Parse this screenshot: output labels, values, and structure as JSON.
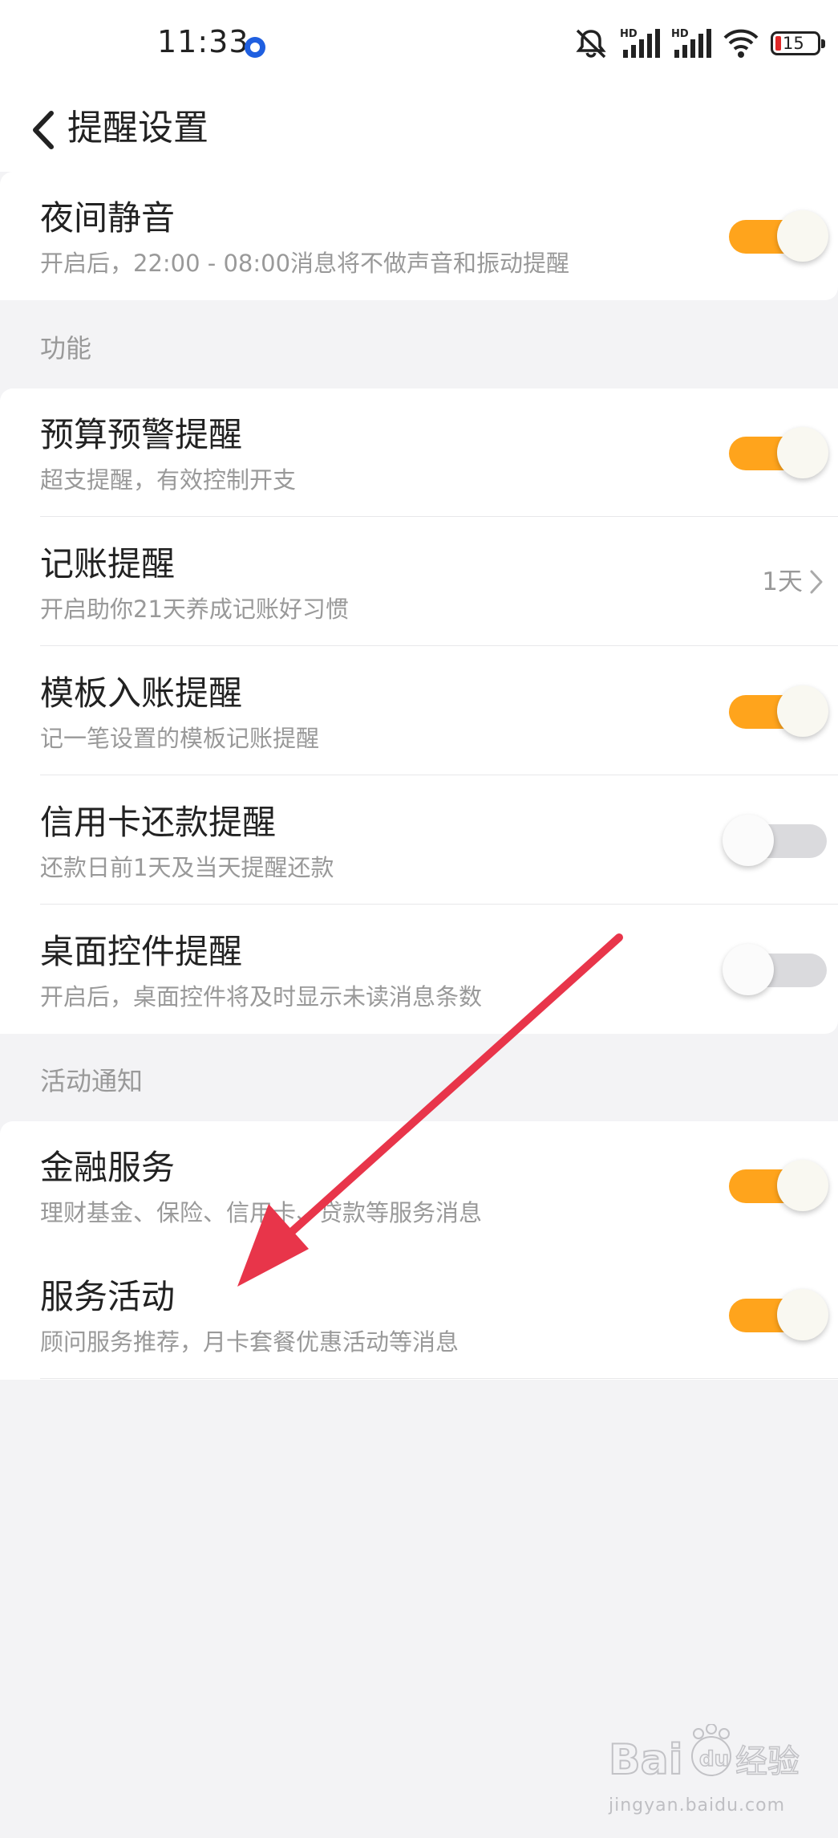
{
  "status_bar": {
    "time": "11:33",
    "battery": "15",
    "hd_label": "HD"
  },
  "header": {
    "title": "提醒设置"
  },
  "night_mute": {
    "title": "夜间静音",
    "subtitle": "开启后，22:00 - 08:00消息将不做声音和振动提醒",
    "enabled": true
  },
  "features": {
    "section_label": "功能",
    "items": [
      {
        "title": "预算预警提醒",
        "subtitle": "超支提醒，有效控制开支",
        "enabled": true
      },
      {
        "title": "记账提醒",
        "subtitle": "开启助你21天养成记账好习惯",
        "value": "1天"
      },
      {
        "title": "模板入账提醒",
        "subtitle": "记一笔设置的模板记账提醒",
        "enabled": true
      },
      {
        "title": "信用卡还款提醒",
        "subtitle": "还款日前1天及当天提醒还款",
        "enabled": false
      },
      {
        "title": "桌面控件提醒",
        "subtitle": "开启后，桌面控件将及时显示未读消息条数",
        "enabled": false
      }
    ]
  },
  "activity": {
    "section_label": "活动通知",
    "items": [
      {
        "title": "金融服务",
        "subtitle": "理财基金、保险、信用卡、贷款等服务消息",
        "enabled": true
      },
      {
        "title": "服务活动",
        "subtitle": "顾问服务推荐，月卡套餐优惠活动等消息",
        "enabled": true
      }
    ]
  },
  "colors": {
    "toggle_on": "#ffa41c",
    "toggle_off": "#dadadd",
    "annotation_arrow": "#e8354a"
  },
  "watermark": {
    "brand": "Bai",
    "brand_suffix": "du",
    "brand_cn": "经验",
    "url": "jingyan.baidu.com"
  }
}
